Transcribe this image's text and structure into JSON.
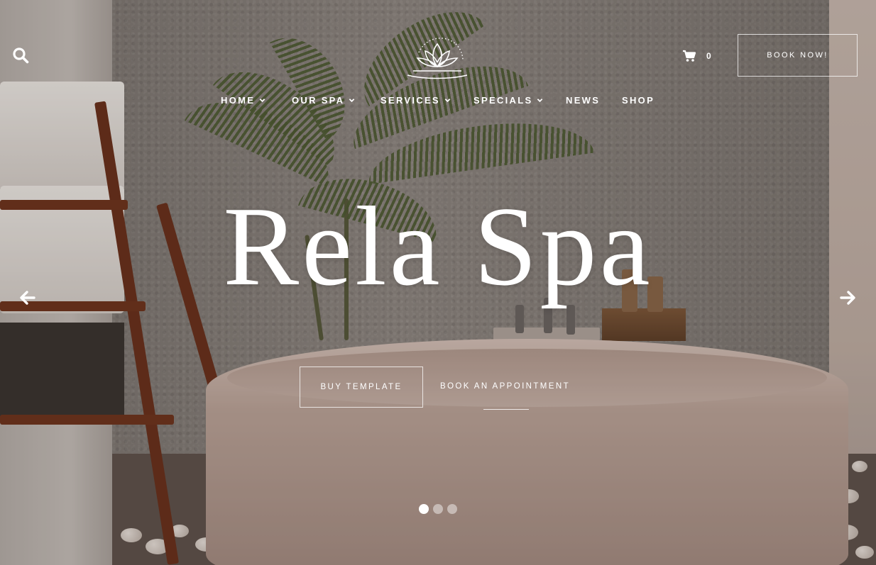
{
  "header": {
    "search_icon": "search-icon",
    "logo_icon": "lotus-logo-icon",
    "cart": {
      "icon": "cart-icon",
      "count": "0"
    },
    "book_now_label": "BOOK NOW!"
  },
  "nav": {
    "items": [
      {
        "label": "HOME",
        "has_dropdown": true
      },
      {
        "label": "OUR SPA",
        "has_dropdown": true
      },
      {
        "label": "SERVICES",
        "has_dropdown": true
      },
      {
        "label": "SPECIALS",
        "has_dropdown": true
      },
      {
        "label": "NEWS",
        "has_dropdown": false
      },
      {
        "label": "SHOP",
        "has_dropdown": false
      }
    ]
  },
  "hero": {
    "title": "Rela Spa",
    "primary_button": "BUY TEMPLATE",
    "secondary_link": "BOOK AN APPOINTMENT",
    "prev_icon": "arrow-left-icon",
    "next_icon": "arrow-right-icon"
  },
  "slider": {
    "total": 3,
    "active_index": 0
  },
  "colors": {
    "text": "#ffffff",
    "overlay": "#281c18"
  }
}
